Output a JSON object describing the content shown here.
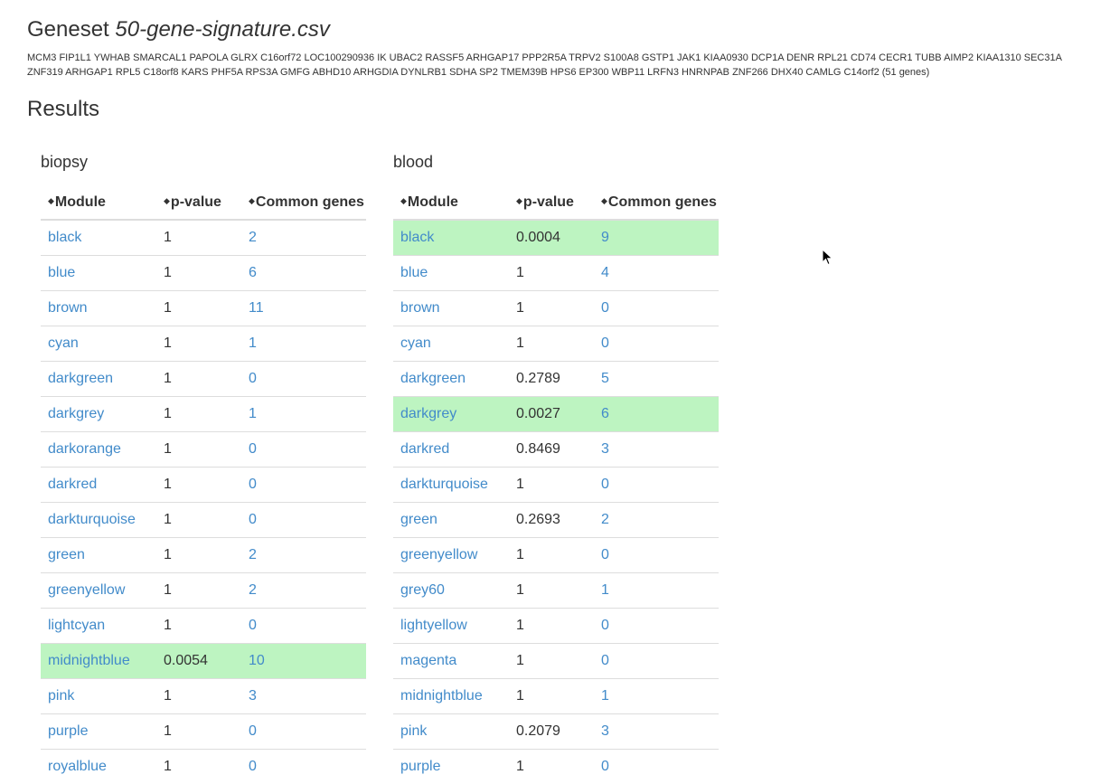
{
  "geneset": {
    "label": "Geneset",
    "filename": "50-gene-signature.csv",
    "genes_text": "MCM3 FIP1L1 YWHAB SMARCAL1 PAPOLA GLRX C16orf72 LOC100290936 IK UBAC2 RASSF5 ARHGAP17 PPP2R5A TRPV2 S100A8 GSTP1 JAK1 KIAA0930 DCP1A DENR RPL21 CD74 CECR1 TUBB AIMP2 KIAA1310 SEC31A ZNF319 ARHGAP1 RPL5 C18orf8 KARS PHF5A RPS3A GMFG ABHD10 ARHGDIA DYNLRB1 SDHA SP2 TMEM39B HPS6 EP300 WBP11 LRFN3 HNRNPAB ZNF266 DHX40 CAMLG C14orf2 (51 genes)"
  },
  "results_heading": "Results",
  "columns": {
    "module": "Module",
    "pvalue": "p-value",
    "common": "Common genes"
  },
  "highlight_color": "#bdf4c1",
  "link_color": "#428bca",
  "panels": [
    {
      "title": "biopsy",
      "rows": [
        {
          "module": "black",
          "p": "1",
          "common": "2",
          "highlight": false
        },
        {
          "module": "blue",
          "p": "1",
          "common": "6",
          "highlight": false
        },
        {
          "module": "brown",
          "p": "1",
          "common": "11",
          "highlight": false
        },
        {
          "module": "cyan",
          "p": "1",
          "common": "1",
          "highlight": false
        },
        {
          "module": "darkgreen",
          "p": "1",
          "common": "0",
          "highlight": false
        },
        {
          "module": "darkgrey",
          "p": "1",
          "common": "1",
          "highlight": false
        },
        {
          "module": "darkorange",
          "p": "1",
          "common": "0",
          "highlight": false
        },
        {
          "module": "darkred",
          "p": "1",
          "common": "0",
          "highlight": false
        },
        {
          "module": "darkturquoise",
          "p": "1",
          "common": "0",
          "highlight": false
        },
        {
          "module": "green",
          "p": "1",
          "common": "2",
          "highlight": false
        },
        {
          "module": "greenyellow",
          "p": "1",
          "common": "2",
          "highlight": false
        },
        {
          "module": "lightcyan",
          "p": "1",
          "common": "0",
          "highlight": false
        },
        {
          "module": "midnightblue",
          "p": "0.0054",
          "common": "10",
          "highlight": true
        },
        {
          "module": "pink",
          "p": "1",
          "common": "3",
          "highlight": false
        },
        {
          "module": "purple",
          "p": "1",
          "common": "0",
          "highlight": false
        },
        {
          "module": "royalblue",
          "p": "1",
          "common": "0",
          "highlight": false
        }
      ]
    },
    {
      "title": "blood",
      "rows": [
        {
          "module": "black",
          "p": "0.0004",
          "common": "9",
          "highlight": true
        },
        {
          "module": "blue",
          "p": "1",
          "common": "4",
          "highlight": false
        },
        {
          "module": "brown",
          "p": "1",
          "common": "0",
          "highlight": false
        },
        {
          "module": "cyan",
          "p": "1",
          "common": "0",
          "highlight": false
        },
        {
          "module": "darkgreen",
          "p": "0.2789",
          "common": "5",
          "highlight": false
        },
        {
          "module": "darkgrey",
          "p": "0.0027",
          "common": "6",
          "highlight": true
        },
        {
          "module": "darkred",
          "p": "0.8469",
          "common": "3",
          "highlight": false
        },
        {
          "module": "darkturquoise",
          "p": "1",
          "common": "0",
          "highlight": false
        },
        {
          "module": "green",
          "p": "0.2693",
          "common": "2",
          "highlight": false
        },
        {
          "module": "greenyellow",
          "p": "1",
          "common": "0",
          "highlight": false
        },
        {
          "module": "grey60",
          "p": "1",
          "common": "1",
          "highlight": false
        },
        {
          "module": "lightyellow",
          "p": "1",
          "common": "0",
          "highlight": false
        },
        {
          "module": "magenta",
          "p": "1",
          "common": "0",
          "highlight": false
        },
        {
          "module": "midnightblue",
          "p": "1",
          "common": "1",
          "highlight": false
        },
        {
          "module": "pink",
          "p": "0.2079",
          "common": "3",
          "highlight": false
        },
        {
          "module": "purple",
          "p": "1",
          "common": "0",
          "highlight": false
        }
      ]
    }
  ]
}
